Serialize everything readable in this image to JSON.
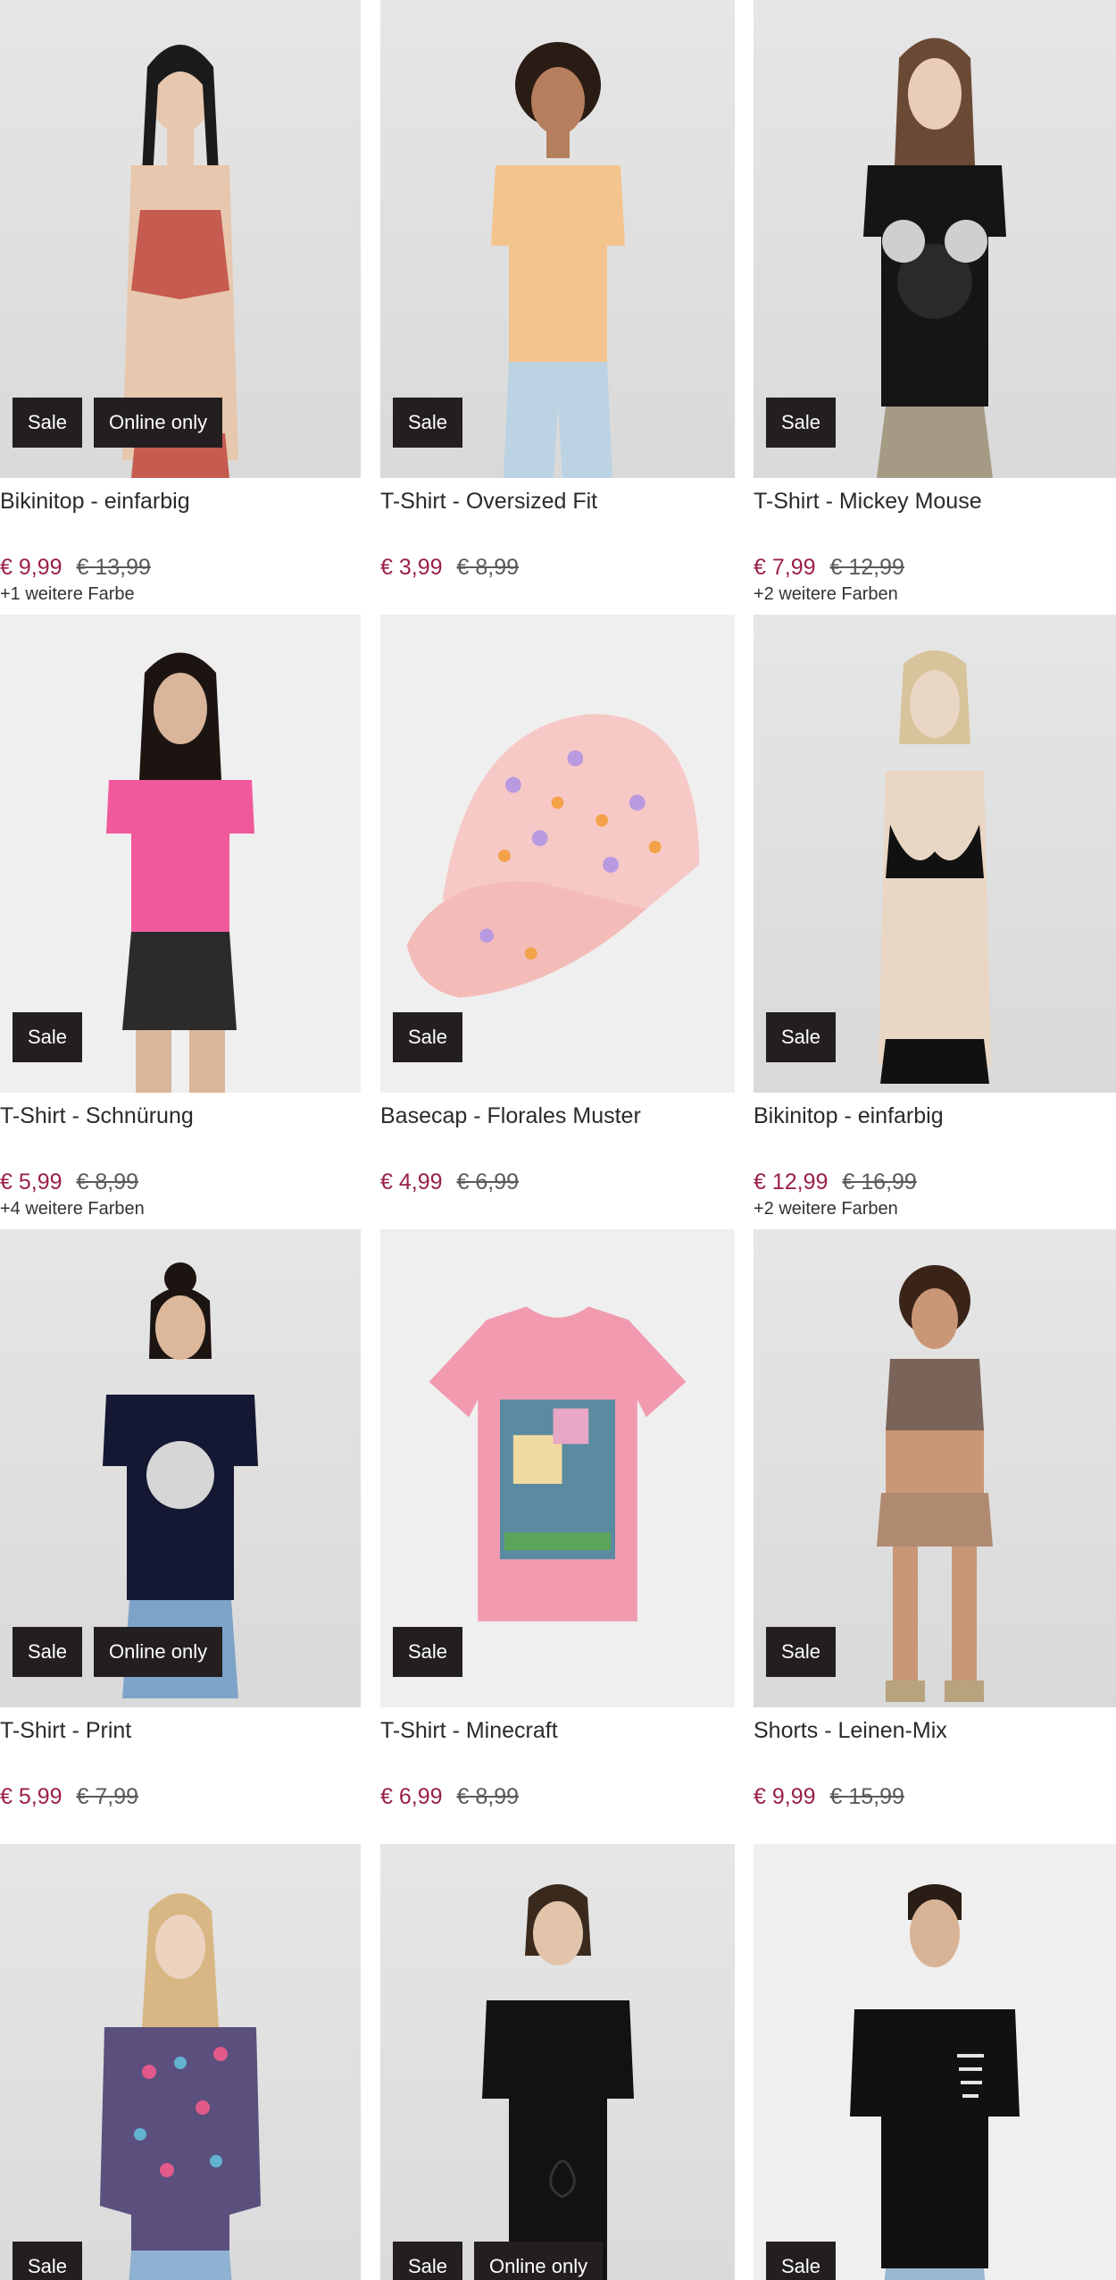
{
  "products": [
    {
      "title": "Bikinitop - einfarbig",
      "price": "€ 9,99",
      "old_price": "€ 13,99",
      "colors": "+1 weitere Farbe",
      "badges": [
        "Sale",
        "Online only"
      ],
      "image": "bikini-top-red"
    },
    {
      "title": "T-Shirt - Oversized Fit",
      "price": "€ 3,99",
      "old_price": "€ 8,99",
      "colors": "",
      "badges": [
        "Sale"
      ],
      "image": "tshirt-peach"
    },
    {
      "title": "T-Shirt - Mickey Mouse",
      "price": "€ 7,99",
      "old_price": "€ 12,99",
      "colors": "+2 weitere Farben",
      "badges": [
        "Sale"
      ],
      "image": "tshirt-black-mickey"
    },
    {
      "title": "T-Shirt - Schnürung",
      "price": "€ 5,99",
      "old_price": "€ 8,99",
      "colors": "+4 weitere Farben",
      "badges": [
        "Sale"
      ],
      "image": "tshirt-pink"
    },
    {
      "title": "Basecap - Florales Muster",
      "price": "€ 4,99",
      "old_price": "€ 6,99",
      "colors": "",
      "badges": [
        "Sale"
      ],
      "image": "cap-floral"
    },
    {
      "title": "Bikinitop - einfarbig",
      "price": "€ 12,99",
      "old_price": "€ 16,99",
      "colors": "+2 weitere Farben",
      "badges": [
        "Sale"
      ],
      "image": "bikini-top-black"
    },
    {
      "title": "T-Shirt - Print",
      "price": "€ 5,99",
      "old_price": "€ 7,99",
      "colors": "",
      "badges": [
        "Sale",
        "Online only"
      ],
      "image": "tshirt-navy-print"
    },
    {
      "title": "T-Shirt - Minecraft",
      "price": "€ 6,99",
      "old_price": "€ 8,99",
      "colors": "",
      "badges": [
        "Sale"
      ],
      "image": "tshirt-pink-minecraft"
    },
    {
      "title": "Shorts - Leinen-Mix",
      "price": "€ 9,99",
      "old_price": "€ 15,99",
      "colors": "",
      "badges": [
        "Sale"
      ],
      "image": "shorts-linen"
    },
    {
      "title": "",
      "price": "",
      "old_price": "",
      "colors": "",
      "badges": [
        "Sale"
      ],
      "image": "blouse-floral"
    },
    {
      "title": "",
      "price": "",
      "old_price": "",
      "colors": "",
      "badges": [
        "Sale",
        "Online only"
      ],
      "image": "tshirt-black-women"
    },
    {
      "title": "",
      "price": "",
      "old_price": "",
      "colors": "",
      "badges": [
        "Sale"
      ],
      "image": "tshirt-black-men"
    }
  ],
  "colors": {
    "price_sale": "#9a2049",
    "badge_bg": "#231f20",
    "badge_text": "#ffffff"
  }
}
